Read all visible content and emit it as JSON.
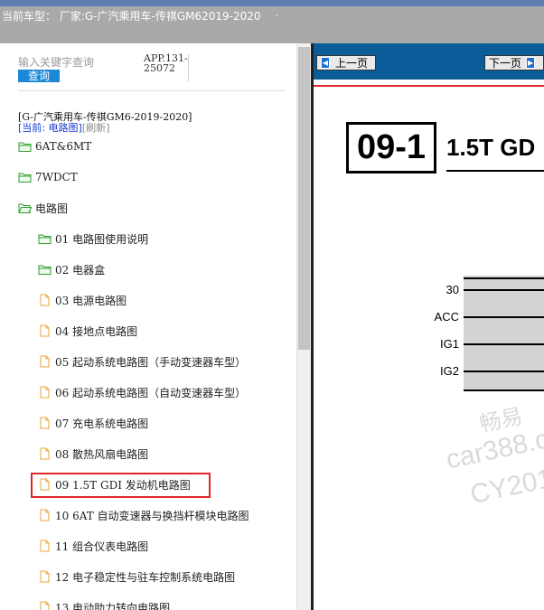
{
  "header": {
    "title": "当前车型： 厂家:G-广汽乘用车-传祺GM62019-2020",
    "trailing_dot": "."
  },
  "search": {
    "placeholder": "输入关键字查询",
    "button_label": "查询",
    "app_id": "APP.131-25072"
  },
  "vehicle": {
    "name": "[G-广汽乘用车-传祺GM6-2019-2020]",
    "current_label": "[当前: 电路图]",
    "refresh_label": "[刷新]"
  },
  "tree": {
    "items": [
      {
        "label": "6AT&6MT",
        "type": "folder"
      },
      {
        "label": "7WDCT",
        "type": "folder"
      },
      {
        "label": "电路图",
        "type": "folder-open"
      },
      {
        "label": "01 电路图使用说明",
        "type": "folder"
      },
      {
        "label": "02 电器盒",
        "type": "folder"
      },
      {
        "label": "03 电源电路图",
        "type": "file"
      },
      {
        "label": "04 接地点电路图",
        "type": "file"
      },
      {
        "label": "05 起动系统电路图（手动变速器车型）",
        "type": "file"
      },
      {
        "label": "06 起动系统电路图（自动变速器车型）",
        "type": "file"
      },
      {
        "label": "07 充电系统电路图",
        "type": "file"
      },
      {
        "label": "08 散热风扇电路图",
        "type": "file"
      },
      {
        "label": "09 1.5T GDI 发动机电路图",
        "type": "file",
        "selected": true
      },
      {
        "label": "10 6AT 自动变速器与换挡杆模块电路图",
        "type": "file"
      },
      {
        "label": "11 组合仪表电路图",
        "type": "file"
      },
      {
        "label": "12 电子稳定性与驻车控制系统电路图",
        "type": "file"
      },
      {
        "label": "13 电动助力转向电路图",
        "type": "file"
      }
    ]
  },
  "viewer": {
    "prev_label": "上一页",
    "next_label": "下一页",
    "section_number": "09-1",
    "section_title": "1.5T GD",
    "power_labels": [
      "30",
      "ACC",
      "IG1",
      "IG2"
    ],
    "watermark": [
      "畅易",
      "car388.c",
      "CY201"
    ]
  },
  "colors": {
    "nav_bg": "#0b5d99",
    "highlight": "#e0252a",
    "query_button": "#1e88d8",
    "folder_green": "#2a9d2a",
    "file_orange": "#e8a53a"
  }
}
